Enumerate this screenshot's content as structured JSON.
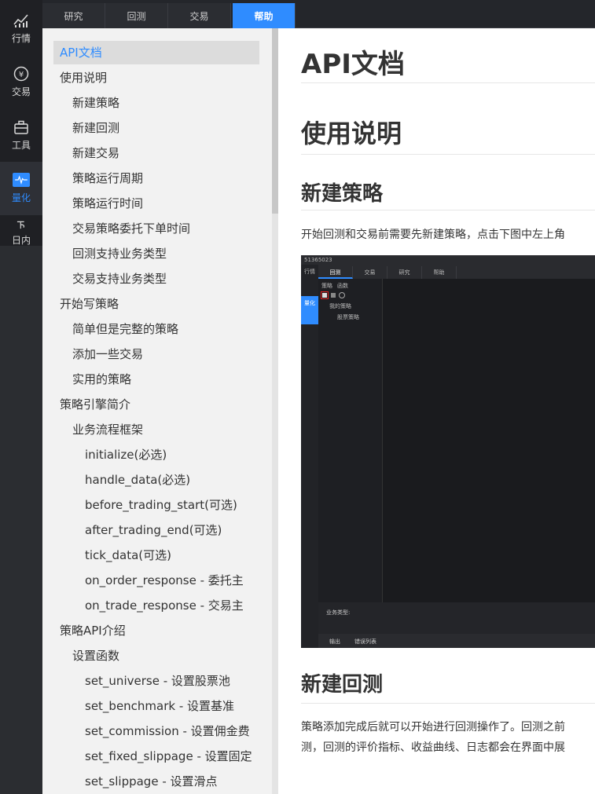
{
  "rail": {
    "items": [
      {
        "label": "行情",
        "icon": "market-chart-icon"
      },
      {
        "label": "交易",
        "icon": "yen-exchange-icon"
      },
      {
        "label": "工具",
        "icon": "toolbox-icon"
      },
      {
        "label": "量化",
        "icon": "quant-pulse-icon"
      },
      {
        "label": "日内",
        "icon": "intraday-icon"
      }
    ],
    "active": "量化"
  },
  "tabs": [
    "研究",
    "回测",
    "交易",
    "帮助"
  ],
  "active_tab": "帮助",
  "toc": [
    {
      "label": "API文档",
      "level": 0,
      "selected": true
    },
    {
      "label": "使用说明",
      "level": 0
    },
    {
      "label": "新建策略",
      "level": 1
    },
    {
      "label": "新建回测",
      "level": 1
    },
    {
      "label": "新建交易",
      "level": 1
    },
    {
      "label": "策略运行周期",
      "level": 1
    },
    {
      "label": "策略运行时间",
      "level": 1
    },
    {
      "label": "交易策略委托下单时间",
      "level": 1
    },
    {
      "label": "回测支持业务类型",
      "level": 1
    },
    {
      "label": "交易支持业务类型",
      "level": 1
    },
    {
      "label": "开始写策略",
      "level": 0
    },
    {
      "label": "简单但是完整的策略",
      "level": 1
    },
    {
      "label": "添加一些交易",
      "level": 1
    },
    {
      "label": "实用的策略",
      "level": 1
    },
    {
      "label": "策略引擎简介",
      "level": 0
    },
    {
      "label": "业务流程框架",
      "level": 1
    },
    {
      "label": "initialize(必选)",
      "level": 2
    },
    {
      "label": "handle_data(必选)",
      "level": 2
    },
    {
      "label": "before_trading_start(可选)",
      "level": 2
    },
    {
      "label": "after_trading_end(可选)",
      "level": 2
    },
    {
      "label": "tick_data(可选)",
      "level": 2
    },
    {
      "label": "on_order_response - 委托主",
      "level": 2
    },
    {
      "label": "on_trade_response - 交易主",
      "level": 2
    },
    {
      "label": "策略API介绍",
      "level": 0
    },
    {
      "label": "设置函数",
      "level": 1
    },
    {
      "label": "set_universe - 设置股票池",
      "level": 2
    },
    {
      "label": "set_benchmark - 设置基准",
      "level": 2
    },
    {
      "label": "set_commission - 设置佣金费",
      "level": 2
    },
    {
      "label": "set_fixed_slippage - 设置固定",
      "level": 2
    },
    {
      "label": "set_slippage - 设置滑点",
      "level": 2
    }
  ],
  "content": {
    "h1": "API文档",
    "h2": "使用说明",
    "h3a": "新建策略",
    "p1": "开始回测和交易前需要先新建策略，点击下图中左上角",
    "h3b": "新建回测",
    "p2a": "策略添加完成后就可以开始进行回测操作了。回测之前",
    "p2b": "测，回测的评价指标、收益曲线、日志都会在界面中展"
  },
  "screenshot": {
    "title": "51365023",
    "rail": [
      "行情",
      "量化"
    ],
    "tabs": [
      "回测",
      "交易",
      "研究",
      "帮助"
    ],
    "subtabs": [
      "策略",
      "函数"
    ],
    "tree": [
      "我的策略",
      "股票策略"
    ],
    "bottom_label": "业务类型:",
    "bottom_tabs": [
      "输出",
      "错误列表"
    ]
  }
}
